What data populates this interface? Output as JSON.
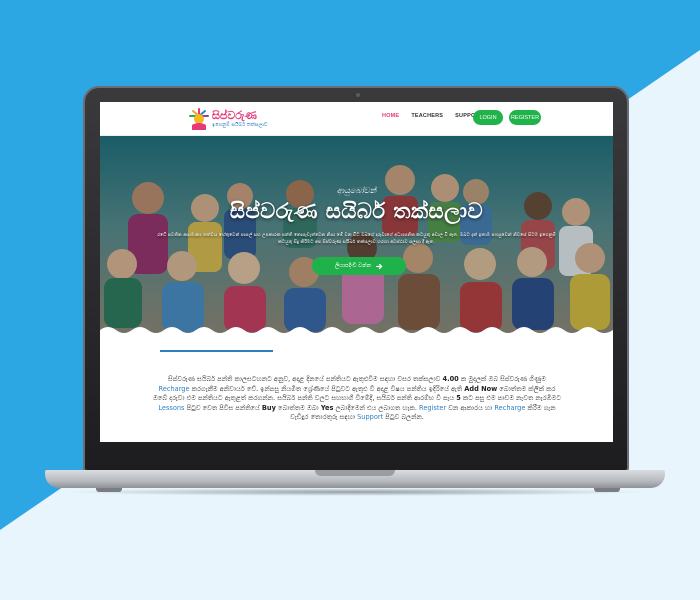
{
  "colors": {
    "background_blue": "#2da6e4",
    "background_light": "#e8f5fc",
    "brand_pink": "#e5397a",
    "brand_green": "#1fb24b",
    "link_blue": "#2d7fc4"
  },
  "logo": {
    "title": "සිප්වරුණ",
    "subtitle": "ඉගෙනුම් සයිබර් තක්සලාව"
  },
  "nav": {
    "links": [
      "HOME",
      "TEACHERS",
      "SUPPORT"
    ],
    "login_label": "LOGIN",
    "register_label": "REGISTER"
  },
  "hero": {
    "subtitle": "ආයුබෝවන්",
    "title": "සිප්වරුණ සයිබර් තක්සලාව",
    "description": "රටේ පවතින අසාමාන්‍ය තත්වය හේතුවෙන් පාසල් සහ උපකාරක පන්ති නොපැවැත්වෙන නිසා මේ වන විට ඔබගේ දරුවාගේ අධ්‍යාපනික කටයුතු අඩාල වී ඇත. ඔබට දැන් ඉතාම පහසුවෙන් නිවසේ සිටම ඉගෙනුම් කටයුතු සිදු කිරීමට අප සිප්වරුණ සයිබර් තක්සලාව හරහා අවස්ථාව සලසා දී ඇත.",
    "button_label": "ලියාපදිංචි වන්න",
    "button_icon": "arrow-right-icon"
  },
  "content": {
    "p1": "සිප්වරුණ සයිබර් පන්ති කාලසටහනට අනුව, අදාළ දිනයේ පන්තියට ඇතුළුවීම සඳහා වසර තක්සලාව",
    "price": "4.00",
    "p2": "ක මුදලක් ඔබ සිප්වරුණ ගිණුම",
    "recharge1": "Recharge",
    "p3": "කරගැනීම අනිවාර්ය වේ. ඉන්පසු නියමිත ශ්‍රේණියේ පිටුවට ඇතුළු වී අදාළ විෂය පන්තිය ඉදිරියේ ඇති",
    "add_now": "Add Now",
    "p4": "බොත්තම ක්ලික් කර ඔබේ දරුවා එම පන්තියට ඇතුළත් කරගන්න. සයිබර් පන්ති වලට සහභාගී වීමේදී, සයිබර් පන්ති ආරම්භ වී පැය",
    "hours": "5",
    "p5": "කට පසු එම පාඩම නැවත නැරඹීමට",
    "lessons": "Lessons",
    "p6": "පිටුව වෙත පිවිස පන්තියේ",
    "buy": "Buy",
    "p7": "බොත්තම ඔබා",
    "yes": "Yes",
    "p8": "ලබාදීමෙන් එය ලබාගත හැක.",
    "register": "Register",
    "p9": "වන ආකාරය හා",
    "recharge2": "Recharge",
    "p10": "කිරීම ගැන වැඩිදුර තොරතුරු සඳහා",
    "support": "Support",
    "p11": "පිටුව බලන්න."
  }
}
